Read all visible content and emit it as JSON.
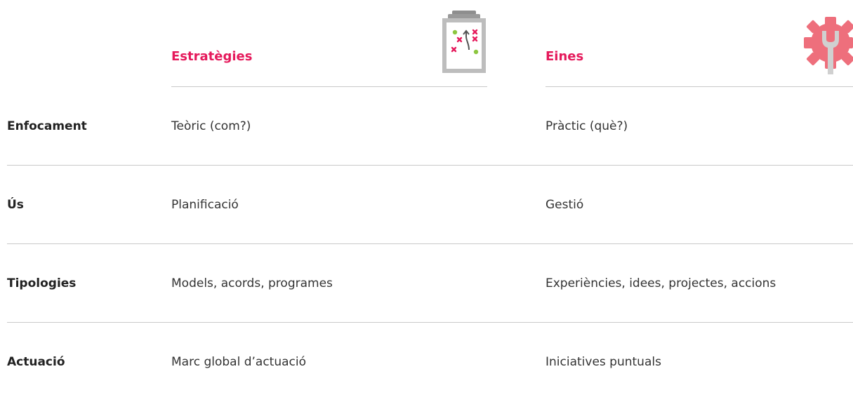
{
  "headers": {
    "col1": "Estratègies",
    "col2": "Eines"
  },
  "icons": {
    "col1": "clipboard-strategy-icon",
    "col2": "gear-wrench-icon"
  },
  "rows": [
    {
      "label": "Enfocament",
      "estrategies": "Teòric (com?)",
      "eines": "Pràctic (què?)"
    },
    {
      "label": "Ús",
      "estrategies": "Planificació",
      "eines": "Gestió"
    },
    {
      "label": "Tipologies",
      "estrategies": "Models, acords, programes",
      "eines": "Experiències, idees, projectes, accions"
    },
    {
      "label": "Actuació",
      "estrategies": "Marc global d’actuació",
      "eines": "Iniciatives puntuals"
    }
  ],
  "colors": {
    "accent": "#e5195b",
    "gear": "#ee6f7c",
    "divider": "#c9c9c9",
    "clipboard": "#b3b3b3",
    "green": "#8cc63f"
  }
}
